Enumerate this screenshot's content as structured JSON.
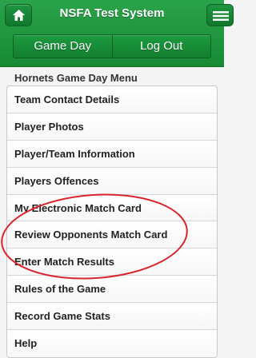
{
  "header": {
    "title": "NSFA Test System",
    "home_icon": "home-icon",
    "menu_icon": "menu-icon"
  },
  "navbar": {
    "items": [
      {
        "label": "Game Day"
      },
      {
        "label": "Log Out"
      }
    ]
  },
  "menu": {
    "title": "Hornets Game Day Menu",
    "items": [
      {
        "label": "Team Contact Details"
      },
      {
        "label": "Player Photos"
      },
      {
        "label": "Player/Team Information"
      },
      {
        "label": "Players Offences"
      },
      {
        "label": "My Electronic Match Card"
      },
      {
        "label": "Review Opponents Match Card"
      },
      {
        "label": "Enter Match Results"
      },
      {
        "label": "Rules of the Game"
      },
      {
        "label": "Record Game Stats"
      },
      {
        "label": "Help"
      }
    ]
  },
  "colors": {
    "header_green": "#188a35",
    "annotation_red": "#d9242b"
  }
}
